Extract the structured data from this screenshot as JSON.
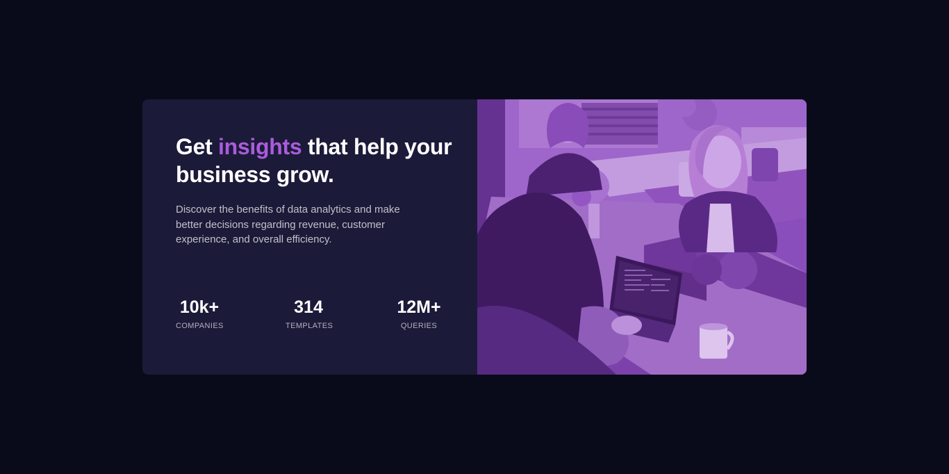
{
  "card": {
    "heading_before": "Get ",
    "heading_accent": "insights",
    "heading_after": " that help your business grow.",
    "description": "Discover the benefits of data analytics and make better decisions regarding revenue, customer experience, and overall efficiency."
  },
  "stats": [
    {
      "value": "10k+",
      "label": "COMPANIES"
    },
    {
      "value": "314",
      "label": "TEMPLATES"
    },
    {
      "value": "12M+",
      "label": "QUERIES"
    }
  ],
  "image": {
    "subject": "people-working-at-table-photo"
  },
  "colors": {
    "page_background": "#090b1a",
    "card_background": "#1c1a39",
    "accent": "#aa5cdb",
    "image_tint": "#8d4dc0"
  }
}
